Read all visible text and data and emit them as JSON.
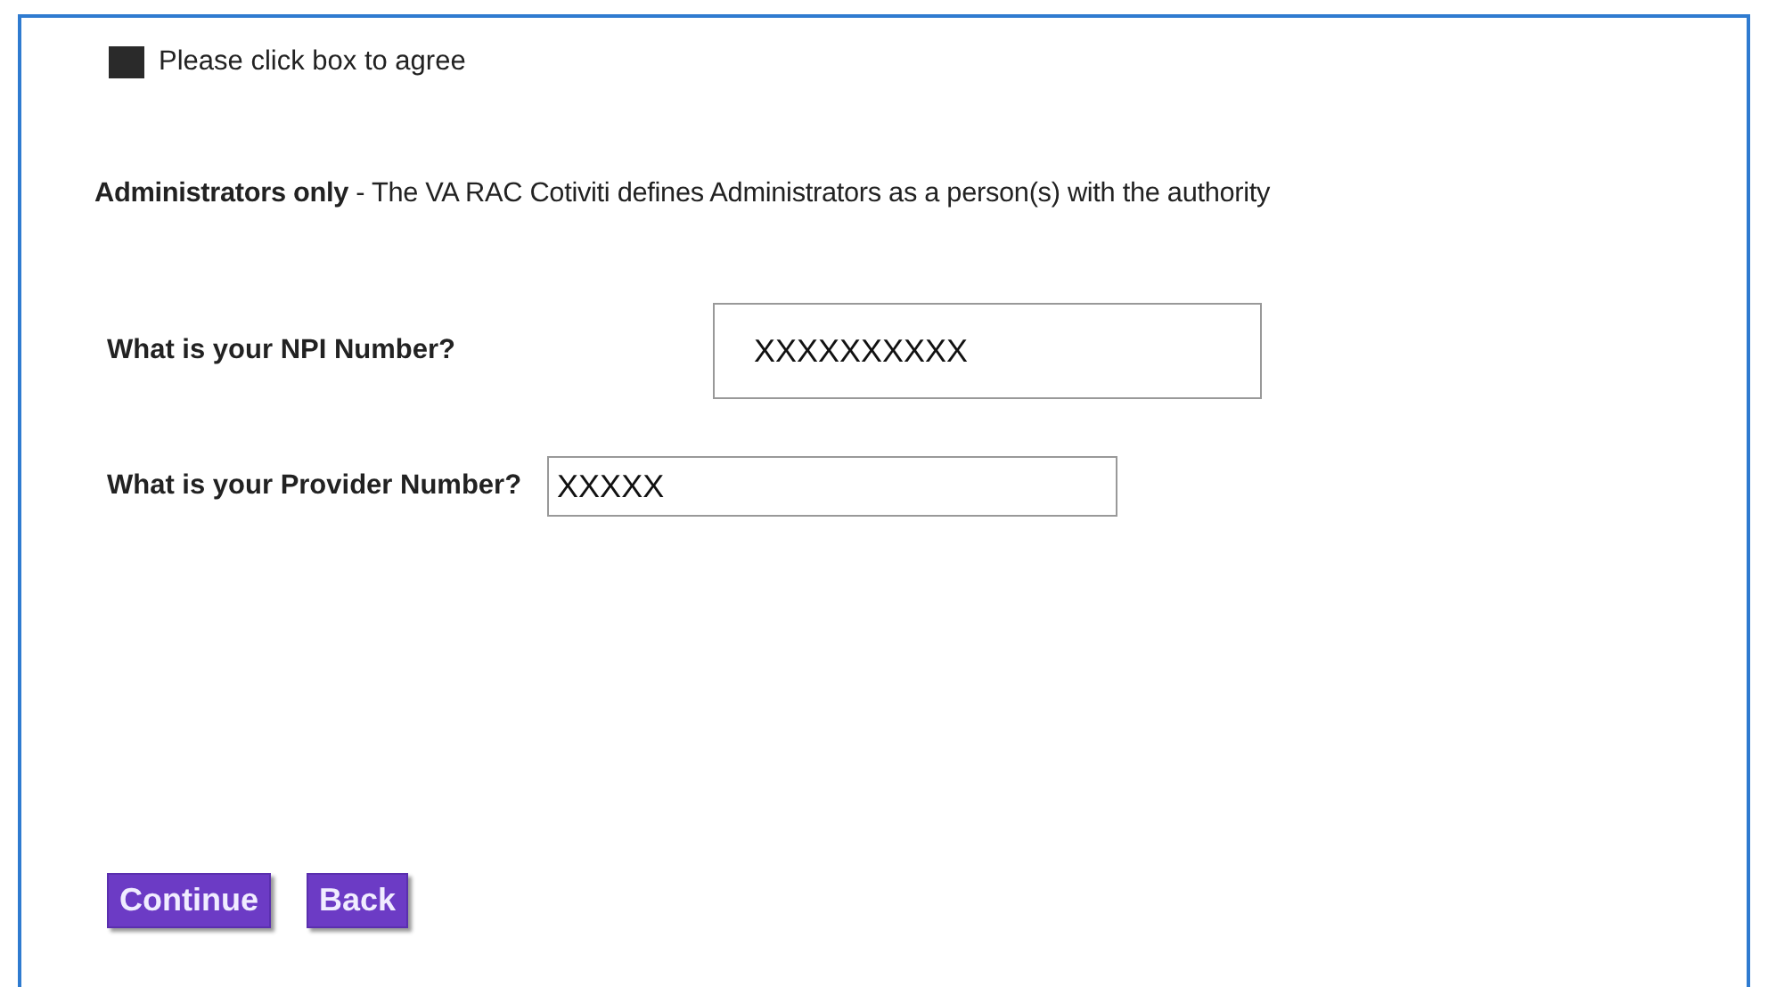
{
  "agree": {
    "label": "Please click box to agree",
    "checked": true
  },
  "notice": "**Administrators only** - The VA RAC Cotiviti defines Administrators as a person(s) with the authority",
  "fields": [
    {
      "label": "What is your NPI Number?",
      "value": "XXXXXXXXXX",
      "kind": "large"
    },
    {
      "label": "What is your Provider Number?",
      "value": "XXXXX",
      "kind": "small"
    }
  ],
  "buttons": [
    "Continue",
    "Back"
  ]
}
